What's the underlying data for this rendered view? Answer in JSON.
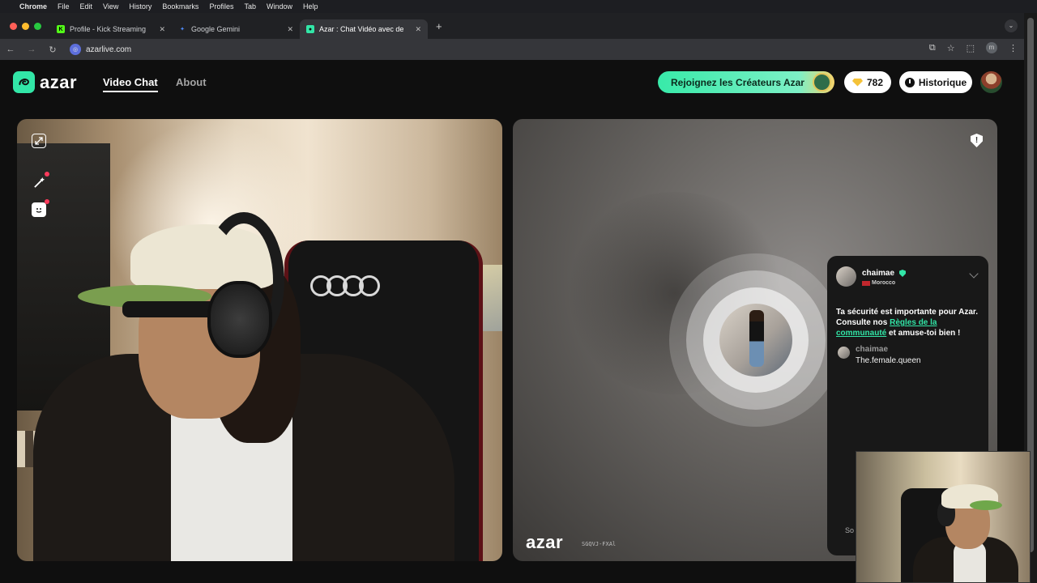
{
  "macos_menu": [
    "Chrome",
    "File",
    "Edit",
    "View",
    "History",
    "Bookmarks",
    "Profiles",
    "Tab",
    "Window",
    "Help"
  ],
  "browser": {
    "tabs": [
      {
        "title": "Profile - Kick Streaming",
        "favicon": "K",
        "color": "#53fc18"
      },
      {
        "title": "Google Gemini",
        "favicon": "✦",
        "color": "#4f8dfd"
      },
      {
        "title": "Azar : Chat Vidéo avec de",
        "favicon": "●",
        "color": "#32e6a7"
      }
    ],
    "url": "azarlive.com",
    "profile_initial": "m"
  },
  "site": {
    "logo": "azar",
    "nav": {
      "video_chat": "Video Chat",
      "about": "About"
    },
    "cta": "Rejoignez les Créateurs Azar",
    "gems": "782",
    "history": "Historique"
  },
  "partner": {
    "name": "chaimae",
    "country": "Morocco",
    "safety_pre": "Ta sécurité est importante pour Azar. Consulte nos ",
    "safety_link": "Règles de la communauté",
    "safety_post": " et amuse-toi bien !",
    "message_name": "chaimae",
    "message_text": "The.female.queen",
    "input_hint": "So"
  },
  "watermark": {
    "logo": "azar",
    "code": "SGQVJ-FXAl"
  },
  "colors": {
    "brand": "#32e6a7",
    "alert": "#ff3b5c",
    "gem": "#f4c238"
  }
}
